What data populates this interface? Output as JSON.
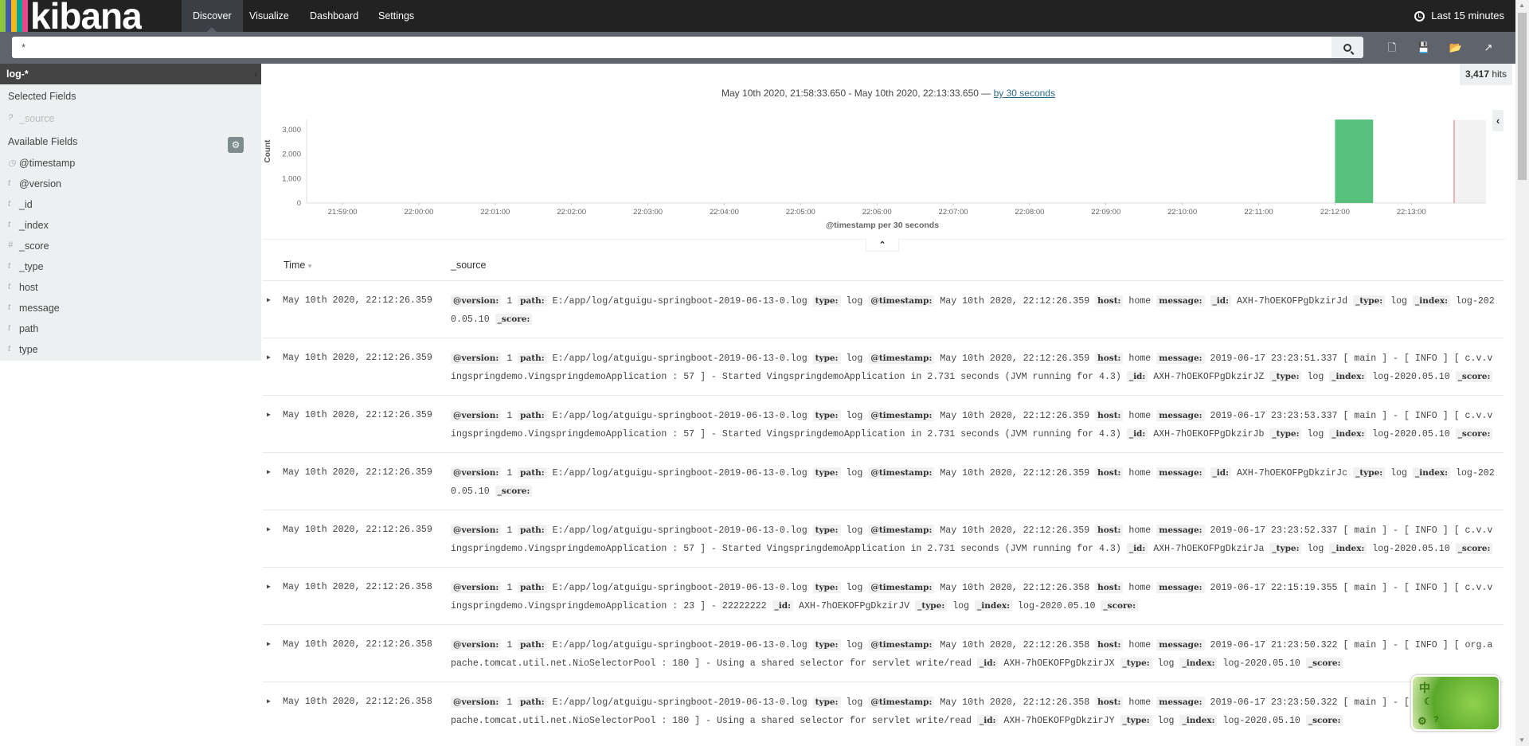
{
  "nav": {
    "logo": "kibana",
    "logo_colors": [
      "#8cc63f",
      "#3f5aa8",
      "#f8b71c",
      "#00a69c",
      "#e8488b"
    ],
    "tabs": [
      {
        "label": "Discover",
        "active": true
      },
      {
        "label": "Visualize"
      },
      {
        "label": "Dashboard"
      },
      {
        "label": "Settings"
      }
    ],
    "time_range": "Last 15 minutes"
  },
  "search": {
    "value": "*",
    "toolbar": [
      "new-search-icon",
      "save-icon",
      "open-icon",
      "share-icon"
    ]
  },
  "sidebar": {
    "index_pattern": "log-*",
    "selected_title": "Selected Fields",
    "selected": [
      {
        "type": "?",
        "name": "_source"
      }
    ],
    "available_title": "Available Fields",
    "available": [
      {
        "type": "clock",
        "name": "@timestamp"
      },
      {
        "type": "t",
        "name": "@version"
      },
      {
        "type": "t",
        "name": "_id"
      },
      {
        "type": "t",
        "name": "_index"
      },
      {
        "type": "#",
        "name": "_score"
      },
      {
        "type": "t",
        "name": "_type"
      },
      {
        "type": "t",
        "name": "host"
      },
      {
        "type": "t",
        "name": "message"
      },
      {
        "type": "t",
        "name": "path"
      },
      {
        "type": "t",
        "name": "type"
      }
    ]
  },
  "hits": {
    "count": "3,417",
    "label": "hits"
  },
  "chart_header": {
    "range": "May 10th 2020, 21:58:33.650 - May 10th 2020, 22:13:33.650 — ",
    "interval_link": "by 30 seconds"
  },
  "chart_data": {
    "type": "bar",
    "ylabel": "Count",
    "xlabel": "@timestamp per 30 seconds",
    "x_ticks": [
      "21:59:00",
      "22:00:00",
      "22:01:00",
      "22:02:00",
      "22:03:00",
      "22:04:00",
      "22:05:00",
      "22:06:00",
      "22:07:00",
      "22:08:00",
      "22:09:00",
      "22:10:00",
      "22:11:00",
      "22:12:00",
      "22:13:00"
    ],
    "y_ticks": [
      "0",
      "1,000",
      "2,000",
      "3,000"
    ],
    "ylim": [
      0,
      3400
    ],
    "xlim": [
      "21:58:33.650",
      "22:13:33.650"
    ],
    "bucket_seconds": 30,
    "bars": [
      {
        "x": "22:12:00",
        "value": 3417
      }
    ],
    "bar_color": "#57c17b",
    "now_marker": "22:13:33.650",
    "now_color": "#e07070"
  },
  "table": {
    "headers": {
      "time": "Time",
      "source": "_source"
    },
    "rows": [
      {
        "time": "May 10th 2020, 22:12:26.359",
        "fields": [
          [
            "@version",
            "1"
          ],
          [
            "path",
            "E:/app/log/atguigu-springboot-2019-06-13-0.log"
          ],
          [
            "type",
            "log"
          ],
          [
            "@timestamp",
            "May 10th 2020, 22:12:26.359"
          ],
          [
            "host",
            "home"
          ],
          [
            "message",
            ""
          ],
          [
            "_id",
            "AXH-7hOEKOFPgDkzirJd"
          ],
          [
            "_type",
            "log"
          ],
          [
            "_index",
            "log-2020.05.10"
          ],
          [
            "_score",
            ""
          ]
        ]
      },
      {
        "time": "May 10th 2020, 22:12:26.359",
        "fields": [
          [
            "@version",
            "1"
          ],
          [
            "path",
            "E:/app/log/atguigu-springboot-2019-06-13-0.log"
          ],
          [
            "type",
            "log"
          ],
          [
            "@timestamp",
            "May 10th 2020, 22:12:26.359"
          ],
          [
            "host",
            "home"
          ],
          [
            "message",
            "2019-06-17 23:23:51.337 [ main ] - [ INFO ] [ c.v.vingspringdemo.VingspringdemoApplication : 57 ] - Started VingspringdemoApplication in 2.731 seconds (JVM running for 4.3)"
          ],
          [
            "_id",
            "AXH-7hOEKOFPgDkzirJZ"
          ],
          [
            "_type",
            "log"
          ],
          [
            "_index",
            "log-2020.05.10"
          ],
          [
            "_score",
            ""
          ]
        ]
      },
      {
        "time": "May 10th 2020, 22:12:26.359",
        "fields": [
          [
            "@version",
            "1"
          ],
          [
            "path",
            "E:/app/log/atguigu-springboot-2019-06-13-0.log"
          ],
          [
            "type",
            "log"
          ],
          [
            "@timestamp",
            "May 10th 2020, 22:12:26.359"
          ],
          [
            "host",
            "home"
          ],
          [
            "message",
            "2019-06-17 23:23:53.337 [ main ] - [ INFO ] [ c.v.vingspringdemo.VingspringdemoApplication : 57 ] - Started VingspringdemoApplication in 2.731 seconds (JVM running for 4.3)"
          ],
          [
            "_id",
            "AXH-7hOEKOFPgDkzirJb"
          ],
          [
            "_type",
            "log"
          ],
          [
            "_index",
            "log-2020.05.10"
          ],
          [
            "_score",
            ""
          ]
        ]
      },
      {
        "time": "May 10th 2020, 22:12:26.359",
        "fields": [
          [
            "@version",
            "1"
          ],
          [
            "path",
            "E:/app/log/atguigu-springboot-2019-06-13-0.log"
          ],
          [
            "type",
            "log"
          ],
          [
            "@timestamp",
            "May 10th 2020, 22:12:26.359"
          ],
          [
            "host",
            "home"
          ],
          [
            "message",
            ""
          ],
          [
            "_id",
            "AXH-7hOEKOFPgDkzirJc"
          ],
          [
            "_type",
            "log"
          ],
          [
            "_index",
            "log-2020.05.10"
          ],
          [
            "_score",
            ""
          ]
        ]
      },
      {
        "time": "May 10th 2020, 22:12:26.359",
        "fields": [
          [
            "@version",
            "1"
          ],
          [
            "path",
            "E:/app/log/atguigu-springboot-2019-06-13-0.log"
          ],
          [
            "type",
            "log"
          ],
          [
            "@timestamp",
            "May 10th 2020, 22:12:26.359"
          ],
          [
            "host",
            "home"
          ],
          [
            "message",
            "2019-06-17 23:23:52.337 [ main ] - [ INFO ] [ c.v.vingspringdemo.VingspringdemoApplication : 57 ] - Started VingspringdemoApplication in 2.731 seconds (JVM running for 4.3)"
          ],
          [
            "_id",
            "AXH-7hOEKOFPgDkzirJa"
          ],
          [
            "_type",
            "log"
          ],
          [
            "_index",
            "log-2020.05.10"
          ],
          [
            "_score",
            ""
          ]
        ]
      },
      {
        "time": "May 10th 2020, 22:12:26.358",
        "fields": [
          [
            "@version",
            "1"
          ],
          [
            "path",
            "E:/app/log/atguigu-springboot-2019-06-13-0.log"
          ],
          [
            "type",
            "log"
          ],
          [
            "@timestamp",
            "May 10th 2020, 22:12:26.358"
          ],
          [
            "host",
            "home"
          ],
          [
            "message",
            "2019-06-17 22:15:19.355 [ main ] - [ INFO ] [ c.v.vingspringdemo.VingspringdemoApplication : 23 ] - 22222222"
          ],
          [
            "_id",
            "AXH-7hOEKOFPgDkzirJV"
          ],
          [
            "_type",
            "log"
          ],
          [
            "_index",
            "log-2020.05.10"
          ],
          [
            "_score",
            ""
          ]
        ]
      },
      {
        "time": "May 10th 2020, 22:12:26.358",
        "fields": [
          [
            "@version",
            "1"
          ],
          [
            "path",
            "E:/app/log/atguigu-springboot-2019-06-13-0.log"
          ],
          [
            "type",
            "log"
          ],
          [
            "@timestamp",
            "May 10th 2020, 22:12:26.358"
          ],
          [
            "host",
            "home"
          ],
          [
            "message",
            "2019-06-17 21:23:50.322 [ main ] - [ INFO ] [ org.apache.tomcat.util.net.NioSelectorPool : 180 ] - Using a shared selector for servlet write/read"
          ],
          [
            "_id",
            "AXH-7hOEKOFPgDkzirJX"
          ],
          [
            "_type",
            "log"
          ],
          [
            "_index",
            "log-2020.05.10"
          ],
          [
            "_score",
            ""
          ]
        ]
      },
      {
        "time": "May 10th 2020, 22:12:26.358",
        "fields": [
          [
            "@version",
            "1"
          ],
          [
            "path",
            "E:/app/log/atguigu-springboot-2019-06-13-0.log"
          ],
          [
            "type",
            "log"
          ],
          [
            "@timestamp",
            "May 10th 2020, 22:12:26.358"
          ],
          [
            "host",
            "home"
          ],
          [
            "message",
            "2019-06-17 23:23:50.322 [ main ] - [ INFO ] [ org.apache.tomcat.util.net.NioSelectorPool : 180 ] - Using a shared selector for servlet write/read"
          ],
          [
            "_id",
            "AXH-7hOEKOFPgDkzirJY"
          ],
          [
            "_type",
            "log"
          ],
          [
            "_index",
            "log-2020.05.10"
          ],
          [
            "_score",
            ""
          ]
        ]
      }
    ]
  },
  "ime": {
    "label": "中"
  }
}
